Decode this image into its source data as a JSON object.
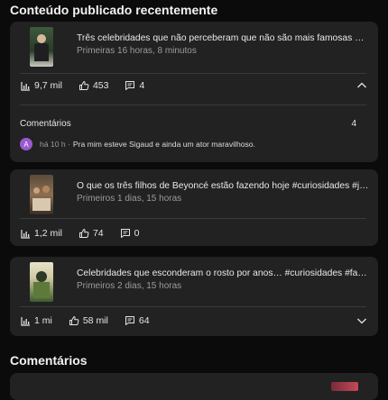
{
  "sections": {
    "recent": "Conteúdo publicado recentemente",
    "comments": "Comentários"
  },
  "posts": [
    {
      "title": "Três celebridades que não perceberam que não são mais famosas #cu…",
      "subtitle": "Primeiras 16 horas, 8 minutos",
      "views": "9,7 mil",
      "likes": "453",
      "comments": "4",
      "expanded": true
    },
    {
      "title": "O que os três filhos de Beyoncé estão fazendo hoje #curiosidades #jay…",
      "subtitle": "Primeiros 1 dias, 15 horas",
      "views": "1,2 mil",
      "likes": "74",
      "comments": "0",
      "expanded": false
    },
    {
      "title": "Celebridades que esconderam o rosto por anos… #curiosidades #famo…",
      "subtitle": "Primeiros 2 dias, 15 horas",
      "views": "1 mi",
      "likes": "58 mil",
      "comments": "64",
      "expanded": false
    }
  ],
  "comments_panel": {
    "label": "Comentários",
    "count": "4",
    "item": {
      "avatar_letter": "A",
      "time": "há 10 h ·",
      "text": "Pra mim esteve Sigaud e ainda um ator maravilhoso."
    }
  },
  "icons": {
    "views": "bar-chart-icon",
    "likes": "thumbs-up-icon",
    "comments": "comment-icon",
    "collapse": "chevron-up-icon",
    "expand": "chevron-down-icon"
  },
  "colors": {
    "background": "#0b0b0b",
    "card": "#222222",
    "avatar": "#9b59d0"
  }
}
